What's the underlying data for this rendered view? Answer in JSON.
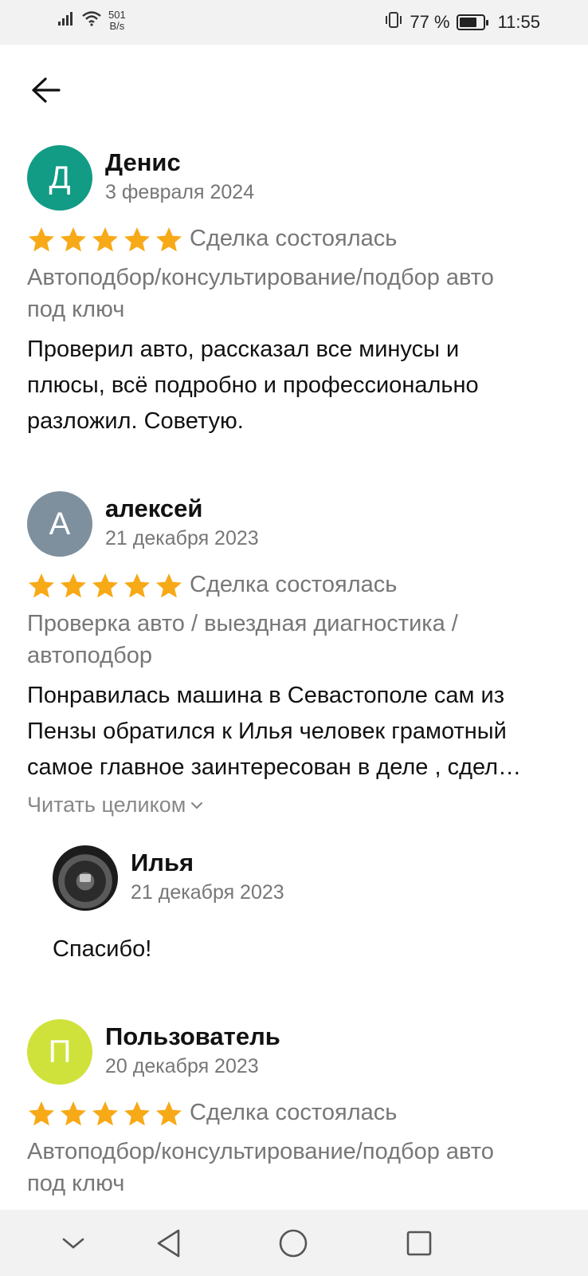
{
  "status_bar": {
    "speed_value": "501",
    "speed_unit": "B/s",
    "battery": "77 %",
    "battery_level": 0.77,
    "time": "11:55"
  },
  "colors": {
    "star": "#f7a917",
    "avatar_d": "#129b85",
    "avatar_a": "#7e909e",
    "avatar_p": "#cfe23b"
  },
  "reviews": [
    {
      "initial": "Д",
      "name": "Денис",
      "date": "3 февраля 2024",
      "rating": 5,
      "deal_status": "Сделка состоялась",
      "category_line1": "Автоподбор/консультирование/подбор авто",
      "category_line2": "под ключ",
      "text_line1": "Проверил авто, рассказал все минусы и",
      "text_line2": "плюсы, всё подробно и профессионально",
      "text_line3": "разложил.  Советую."
    },
    {
      "initial": "А",
      "name": "алексей",
      "date": "21 декабря 2023",
      "rating": 5,
      "deal_status": "Сделка состоялась",
      "category_line1": "Проверка авто / выездная диагностика /",
      "category_line2": "автоподбор",
      "text_line1": "Понравилась  машина в Севастополе сам из",
      "text_line2": "Пензы  обратился к Илья человек грамотный",
      "text_line3": "самое главное заинтересован в деле , сдел…",
      "read_more": "Читать целиком",
      "reply": {
        "name": "Илья",
        "date": "21 декабря 2023",
        "text": "Спасибо!"
      }
    },
    {
      "initial": "П",
      "name": "Пользователь",
      "date": "20 декабря 2023",
      "rating": 5,
      "deal_status": "Сделка состоялась",
      "category_line1": "Автоподбор/консультирование/подбор авто",
      "category_line2": "под ключ"
    }
  ],
  "nav_icons": [
    "chevron-down-icon",
    "back-triangle-icon",
    "home-circle-icon",
    "recents-square-icon"
  ]
}
